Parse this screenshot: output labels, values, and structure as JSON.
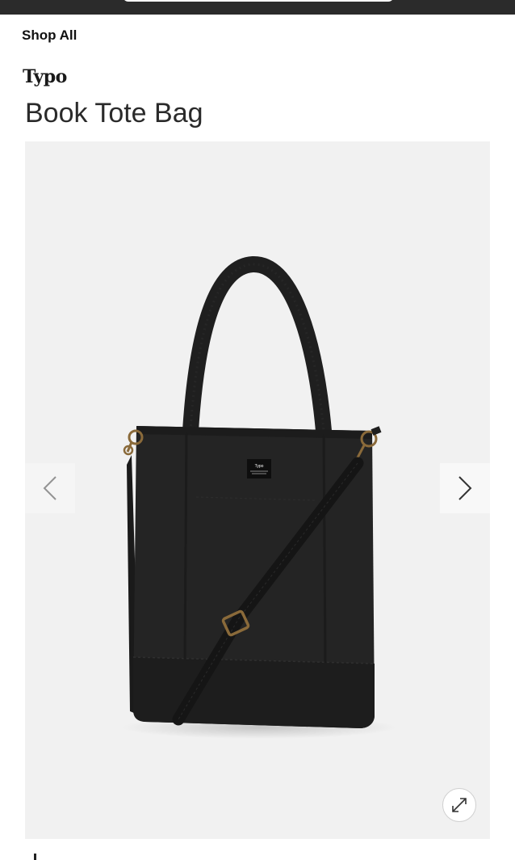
{
  "header": {
    "shop_all_label": "Shop All"
  },
  "product": {
    "brand": "Typo",
    "title": "Book Tote Bag",
    "label_text": "Typo",
    "image_alt": "Black canvas book tote bag with detachable shoulder strap"
  },
  "gallery": {
    "prev_icon": "chevron-left-icon",
    "next_icon": "chevron-right-icon",
    "zoom_icon": "expand-icon"
  },
  "colors": {
    "background": "#ffffff",
    "gallery_bg": "#f1f1f1",
    "bag": "#232323",
    "topbar": "#2b2b2b"
  }
}
